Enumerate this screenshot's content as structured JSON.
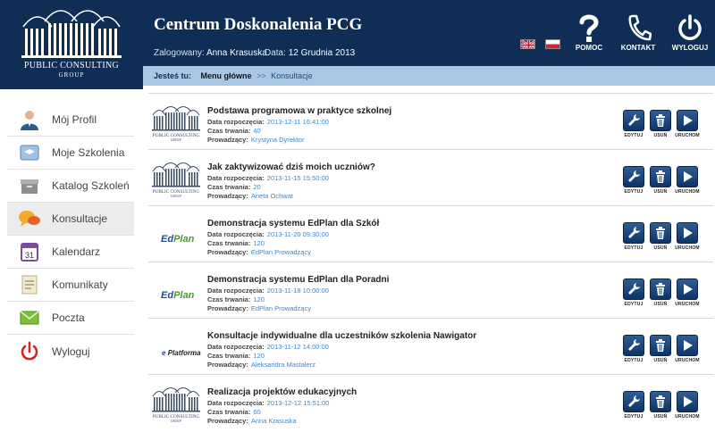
{
  "brand": {
    "line1": "PUBLIC CONSULTING",
    "line2": "GROUP"
  },
  "header": {
    "title": "Centrum Doskonalenia PCG",
    "logged_label": "Zalogowany:",
    "logged_user": "Anna Krasuska",
    "date_label": "Data:",
    "date_value": "12 Grudnia 2013",
    "help_label": "POMOC",
    "contact_label": "KONTAKT",
    "logout_label": "WYLOGUJ",
    "help_icon": "question-icon",
    "contact_icon": "phone-icon",
    "logout_icon": "power-icon"
  },
  "breadcrumb": {
    "label": "Jesteś tu:",
    "current": "Menu główne",
    "separator": ">>",
    "page": "Konsultacje"
  },
  "sidebar": {
    "items": [
      {
        "label": "Mój Profil",
        "icon": "user-icon"
      },
      {
        "label": "Moje Szkolenia",
        "icon": "training-icon"
      },
      {
        "label": "Katalog Szkoleń",
        "icon": "catalog-box-icon"
      },
      {
        "label": "Konsultacje",
        "icon": "chat-bubbles-icon",
        "active": true
      },
      {
        "label": "Kalendarz",
        "icon": "calendar-icon",
        "day": "31"
      },
      {
        "label": "Komunikaty",
        "icon": "notes-icon"
      },
      {
        "label": "Poczta",
        "icon": "mail-icon"
      },
      {
        "label": "Wyloguj",
        "icon": "power-icon"
      }
    ]
  },
  "labels": {
    "start": "Data rozpoczęcia:",
    "duration": "Czas trwania:",
    "host": "Prowadzący:",
    "edit": "EDYTUJ",
    "delete": "USUŃ",
    "run": "URUCHOM"
  },
  "rows": [
    {
      "logo": "pcg",
      "title": "Podstawa programowa w praktyce szkolnej",
      "start": "2013-12-11 16:41:00",
      "duration": "40",
      "host": "Krystyna Dyrektor"
    },
    {
      "logo": "pcg",
      "title": "Jak zaktywizować dziś moich uczniów?",
      "start": "2013-11-15 15:50:00",
      "duration": "20",
      "host": "Aneta Ochwat"
    },
    {
      "logo": "edplan",
      "title": "Demonstracja systemu EdPlan dla Szkół",
      "start": "2013-11-20 09:30:00",
      "duration": "120",
      "host": "EdPlan Prowadzący"
    },
    {
      "logo": "edplan",
      "title": "Demonstracja systemu EdPlan dla Poradni",
      "start": "2013-11-18 10:00:00",
      "duration": "120",
      "host": "EdPlan Prowadzący"
    },
    {
      "logo": "eplatforma",
      "title": "Konsultacje indywidualne dla uczestników szkolenia Nawigator",
      "start": "2013-11-12 14:00:00",
      "duration": "120",
      "host": "Aleksandra Mastalerz"
    },
    {
      "logo": "pcg",
      "title": "Realizacja projektów edukacyjnych",
      "start": "2013-12-12 15:51:00",
      "duration": "60",
      "host": "Anna Krasuska"
    }
  ],
  "logos": {
    "edplan": {
      "a": "Ed",
      "b": "Plan"
    },
    "eplatforma": {
      "a": "e",
      "b": "Platforma"
    },
    "pcg": {
      "a": "PUBLIC CONSULTING",
      "b": "GROUP"
    }
  },
  "colors": {
    "header": "#0f2d55",
    "crumbbar": "#a9c6e4",
    "link": "#3f86c8",
    "button": "#1c4679"
  }
}
